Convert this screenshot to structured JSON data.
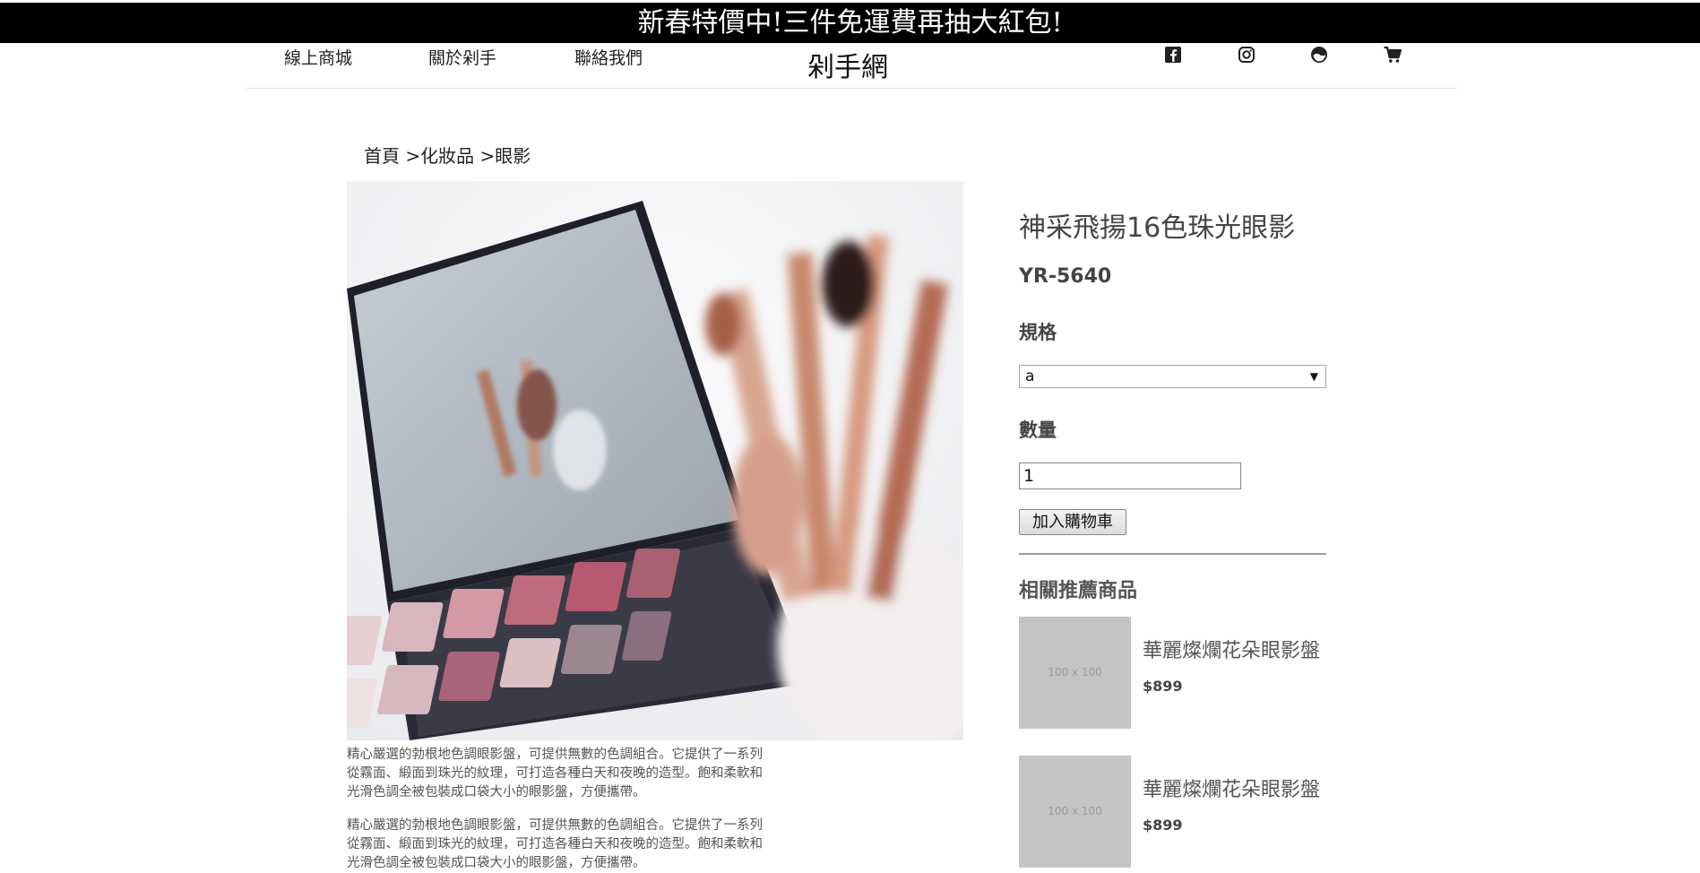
{
  "promo": {
    "text": "新春特價中!三件免運費再抽大紅包!"
  },
  "nav": {
    "links": [
      "線上商城",
      "關於剁手",
      "聯絡我們"
    ],
    "logo": "剁手網",
    "icons": [
      "facebook-icon",
      "instagram-icon",
      "globe-icon",
      "cart-icon"
    ]
  },
  "breadcrumb": "首頁 >化妝品 >眼影",
  "product": {
    "title": "神采飛揚16色珠光眼影",
    "sku": "YR-5640",
    "spec_label": "規格",
    "spec_value": "a",
    "qty_label": "數量",
    "qty_value": "1",
    "add_to_cart": "加入購物車",
    "description": [
      "精心嚴選的勃根地色調眼影盤，可提供無數的色調組合。它提供了一系列從霧面、緞面到珠光的紋理，可打造各種白天和夜晚的造型。飽和柔軟和光滑色調全被包裝成口袋大小的眼影盤，方便攜帶。",
      "精心嚴選的勃根地色調眼影盤，可提供無數的色調組合。它提供了一系列從霧面、緞面到珠光的紋理，可打造各種白天和夜晚的造型。飽和柔軟和光滑色調全被包裝成口袋大小的眼影盤，方便攜帶。"
    ]
  },
  "related": {
    "heading": "相關推薦商品",
    "items": [
      {
        "name": "華麗燦爛花朵眼影盤",
        "price": "$899",
        "thumb": "100 x 100"
      },
      {
        "name": "華麗燦爛花朵眼影盤",
        "price": "$899",
        "thumb": "100 x 100"
      }
    ]
  }
}
